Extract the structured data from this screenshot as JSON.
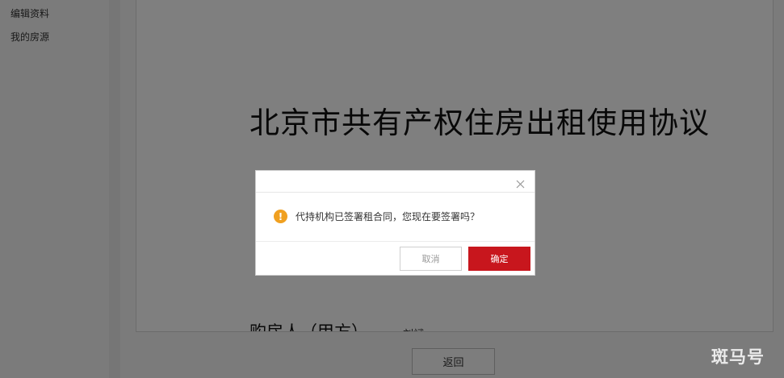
{
  "sidebar": {
    "items": [
      {
        "label": "编辑资料"
      },
      {
        "label": "我的房源"
      }
    ]
  },
  "document": {
    "title": "北京市共有产权住房出租使用协议",
    "buyer_label": "购房人（甲方）",
    "buyer_name": "刘斌"
  },
  "page": {
    "back_label": "返回"
  },
  "dialog": {
    "icon": "warning-icon",
    "message": "代持机构已签署租合同，您现在要签署吗？",
    "cancel_label": "取消",
    "confirm_label": "确定",
    "close_icon": "close-icon"
  },
  "colors": {
    "accent": "#c8161d",
    "warning": "#f0a020"
  },
  "watermark": {
    "text": "斑马号"
  }
}
